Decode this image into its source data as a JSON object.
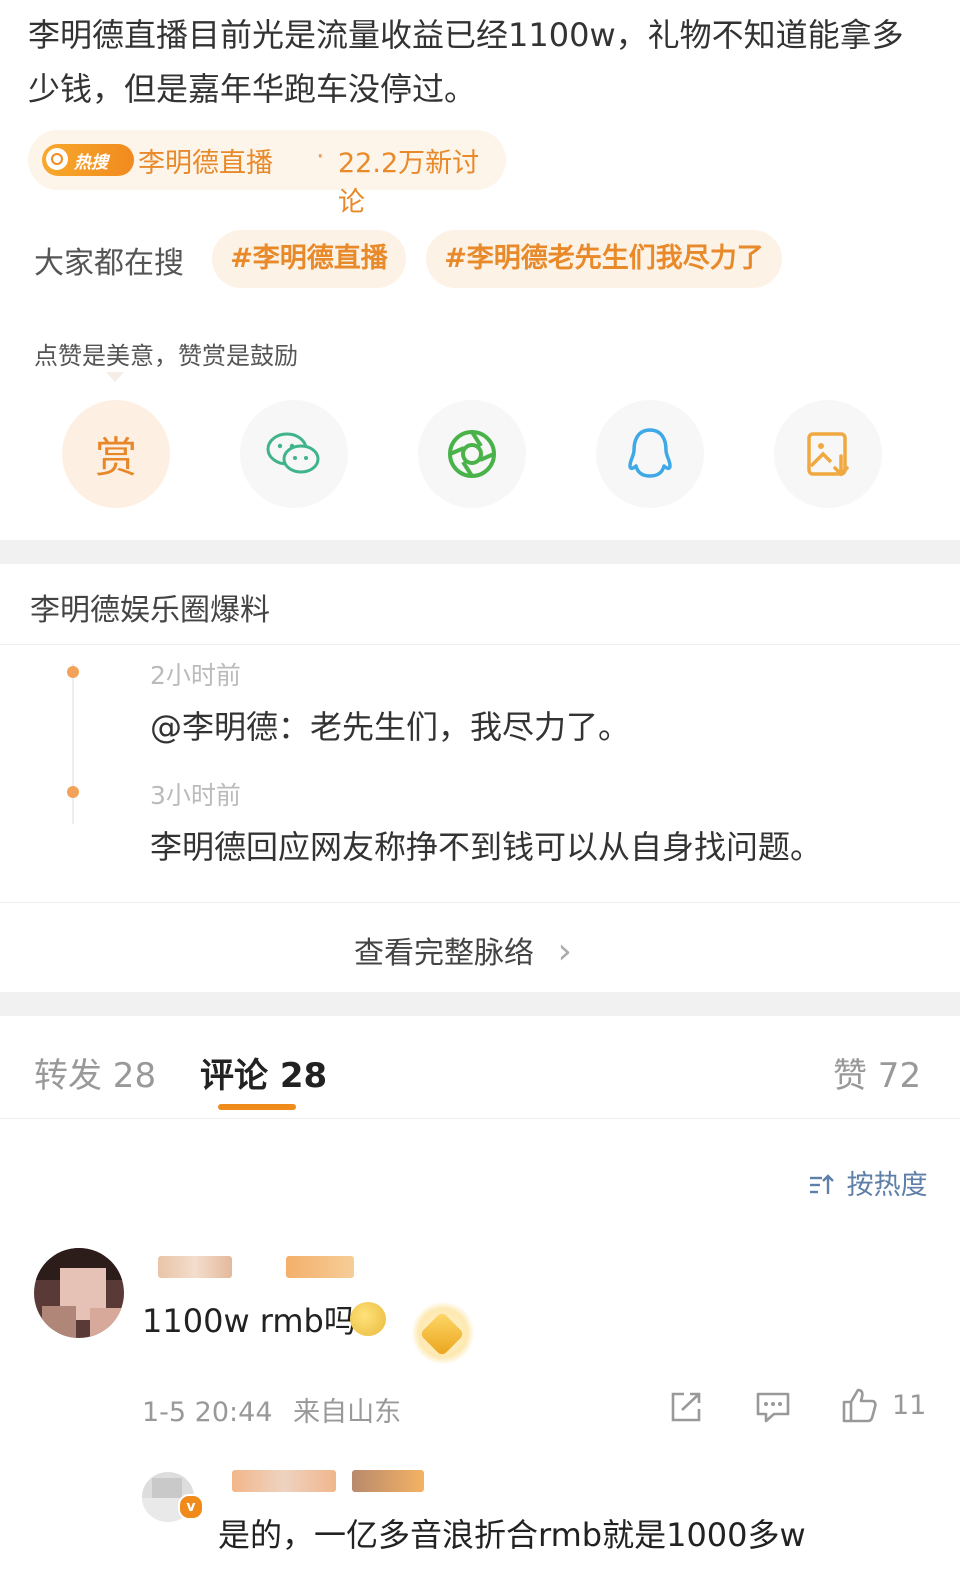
{
  "post": {
    "text": "李明德直播目前光是流量收益已经1100w，礼物不知道能拿多少钱，但是嘉年华跑车没停过。"
  },
  "hot_search": {
    "badge": "热搜",
    "topic": "李明德直播",
    "dot": "·",
    "count": "22.2万新讨论"
  },
  "everyone_searching": {
    "label": "大家都在搜",
    "chips": [
      "#李明德直播",
      "#李明德老先生们我尽力了"
    ]
  },
  "reward": {
    "tip": "点赞是美意，赞赏是鼓励",
    "button_label": "赏"
  },
  "share_icons": [
    "wechat-icon",
    "moments-icon",
    "qq-icon",
    "save-image-icon"
  ],
  "source": {
    "title": "李明德娱乐圈爆料",
    "timeline": [
      {
        "time": "2小时前",
        "text": "@李明德：老先生们，我尽力了。"
      },
      {
        "time": "3小时前",
        "text": "李明德回应网友称挣不到钱可以从自身找问题。"
      }
    ],
    "view_full": "查看完整脉络",
    "chevron": "›"
  },
  "tabs": {
    "repost": "转发 28",
    "comment": "评论 28",
    "like": "赞 72"
  },
  "sort": {
    "label": "按热度"
  },
  "comments": [
    {
      "text": "1100w rmb吗",
      "time": "1-5 20:44",
      "location": "来自山东",
      "likes": "11"
    }
  ],
  "reply": {
    "text": "是的，一亿多音浪折合rmb就是1000多w"
  },
  "colors": {
    "accent": "#f08a1a",
    "hot_text": "#e88a2a",
    "link_blue": "#5e7fa8"
  }
}
